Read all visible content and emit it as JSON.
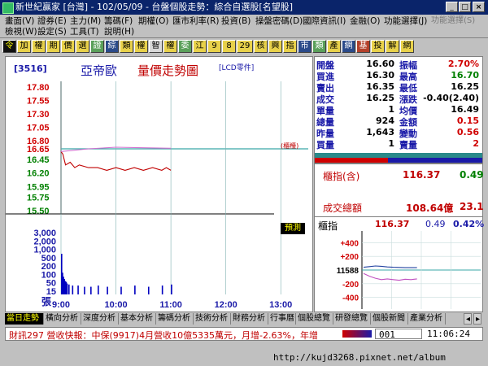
{
  "window": {
    "title": "新世紀贏家 [台灣] - 102/05/09 - 台盤個股走勢：綜合自選股[名望股]",
    "buttons": [
      "_",
      "□",
      "×"
    ]
  },
  "menubar": {
    "row1": [
      "畫面(V)",
      "證券(E)",
      "主力(M)",
      "籌碼(F)",
      "期權(O)",
      "匯市利率(R)",
      "投資(B)",
      "操盤密碼(D)",
      "國際資訊(I)",
      "金融(O)",
      "功能選擇(J)",
      "功能選擇(S)"
    ],
    "row2": [
      "檢視(W)",
      "設定(S)",
      "工具(T)",
      "說明(H)"
    ]
  },
  "toolbar": {
    "items": [
      "令",
      "加",
      "權",
      "期",
      "價",
      "選",
      "證",
      "綜",
      "類",
      "權",
      "智",
      "權",
      "委",
      "江",
      "9",
      "8",
      "29",
      "核",
      "興",
      "指",
      "市",
      "類",
      "產",
      "網",
      "基",
      "投",
      "解",
      "網"
    ]
  },
  "chart": {
    "code": "[3516]",
    "name": "亞帝歐",
    "title": "量價走勢圖",
    "lcd_label": "[LCD零件]",
    "bond_label": "(櫃檯)",
    "predict_label": "預測",
    "vol_unit": "張",
    "colors": {
      "price": "#c00000",
      "avg": "#d070d0",
      "ref": "#3aa7a7",
      "volume": "#0000c0",
      "up": "#d00000",
      "down": "#008000"
    }
  },
  "chart_data": [
    {
      "type": "line",
      "title": "量價走勢圖",
      "x_ticks": [
        "9:00",
        "10:00",
        "11:00",
        "12:00",
        "13:00"
      ],
      "x_range": [
        "9:00",
        "13:30"
      ],
      "ylim": [
        15.5,
        17.8
      ],
      "y_ticks": [
        "17.80",
        "17.55",
        "17.30",
        "17.05",
        "16.80",
        "16.65",
        "16.45",
        "16.20",
        "15.95",
        "15.75",
        "15.50"
      ],
      "reference_line": 16.65,
      "series": [
        {
          "name": "",
          "color": "#c00000",
          "points": [
            [
              "9:00",
              16.6
            ],
            [
              "9:02",
              16.55
            ],
            [
              "9:05",
              16.35
            ],
            [
              "9:10",
              16.4
            ],
            [
              "9:15",
              16.3
            ],
            [
              "9:20",
              16.35
            ],
            [
              "9:30",
              16.3
            ],
            [
              "9:40",
              16.3
            ],
            [
              "9:50",
              16.25
            ],
            [
              "10:00",
              16.3
            ],
            [
              "10:10",
              16.25
            ],
            [
              "10:20",
              16.3
            ],
            [
              "10:30",
              16.25
            ],
            [
              "10:40",
              16.3
            ],
            [
              "10:50",
              16.25
            ],
            [
              "10:55",
              16.3
            ],
            [
              "11:00",
              16.25
            ]
          ]
        },
        {
          "name": "",
          "color": "#d070d0",
          "points": [
            [
              "9:00",
              16.6
            ],
            [
              "9:30",
              16.65
            ],
            [
              "10:00",
              16.68
            ],
            [
              "10:30",
              16.67
            ],
            [
              "11:00",
              16.66
            ]
          ]
        }
      ]
    },
    {
      "type": "bar",
      "ylim": [
        0,
        3000
      ],
      "y_ticks": [
        "3,000",
        "2,000",
        "1,000",
        "500",
        "200",
        "100",
        "50",
        "15"
      ],
      "categories": [
        "9:00",
        "9:01",
        "9:02",
        "9:03",
        "9:04",
        "9:05",
        "9:06",
        "9:08",
        "9:12",
        "9:18",
        "9:25",
        "9:32",
        "9:40",
        "9:50",
        "10:05",
        "10:20",
        "10:35",
        "10:50",
        "11:00"
      ],
      "values": [
        420,
        120,
        80,
        60,
        45,
        40,
        30,
        25,
        20,
        20,
        15,
        15,
        20,
        15,
        15,
        20,
        15,
        20,
        25
      ]
    },
    {
      "type": "line",
      "title": "櫃指",
      "y_ticks": [
        "+400",
        "+200",
        "11588",
        "-200",
        "-400"
      ],
      "ylim": [
        -500,
        500
      ],
      "series": [
        {
          "name": "",
          "color": "#2040a0",
          "values": [
            40,
            50,
            60,
            55,
            45,
            40,
            38,
            35,
            35,
            35
          ]
        },
        {
          "name": "",
          "color": "#c050c0",
          "values": [
            -50,
            -90,
            -120,
            -140,
            -130,
            -140,
            -150,
            -135,
            -140,
            -130
          ]
        }
      ]
    }
  ],
  "quote": {
    "rows": [
      {
        "l1": "開盤",
        "v1": "16.60",
        "l2": "振幅",
        "v2": "2.70%",
        "c1": "#000000",
        "c2": "#d00000"
      },
      {
        "l1": "買進",
        "v1": "16.30",
        "l2": "最高",
        "v2": "16.70",
        "c1": "#000000",
        "c2": "#008000"
      },
      {
        "l1": "賣出",
        "v1": "16.35",
        "l2": "最低",
        "v2": "16.25",
        "c1": "#000000",
        "c2": "#000000"
      },
      {
        "l1": "成交",
        "v1": "16.25",
        "l2": "漲跌",
        "v2": "-0.40(2.40)",
        "c1": "#000000",
        "c2": "#000000"
      },
      {
        "l1": "單量",
        "v1": "1",
        "l2": "均價",
        "v2": "16.49",
        "c1": "#000000",
        "c2": "#000000"
      },
      {
        "l1": "總量",
        "v1": "924",
        "l2": "金額",
        "v2": "0.15",
        "c1": "#000000",
        "c2": "#d00000"
      },
      {
        "l1": "昨量",
        "v1": "1,643",
        "l2": "變動",
        "v2": "0.56",
        "c1": "#000000",
        "c2": "#d00000"
      },
      {
        "l1": "買量",
        "v1": "1",
        "l2": "賣量",
        "v2": "2",
        "c1": "#000000",
        "c2": "#d00000"
      }
    ],
    "index_label": "櫃指(含)",
    "index_value": "116.37",
    "index_change": "0.49",
    "turnover_label": "成交總額",
    "turnover_value": "108.64億",
    "turnover_change": "23.1",
    "mini_title": "櫃指",
    "mini_value": "116.37",
    "mini_change": "0.49",
    "mini_pct": "0.42%"
  },
  "tabs": [
    "當日走勢",
    "橫向分析",
    "深度分析",
    "基本分析",
    "籌碼分析",
    "技術分析",
    "財務分析",
    "行事曆",
    "個股總覽",
    "研發總覽",
    "個股新聞",
    "產業分析"
  ],
  "status": {
    "news": "財訊297 營收快報：中保(9917)4月營收10億5335萬元，月增-2.63%，年增",
    "page_input": "001",
    "clock": "11:06:24"
  },
  "watermark": "http://kujd3268.pixnet.net/album"
}
